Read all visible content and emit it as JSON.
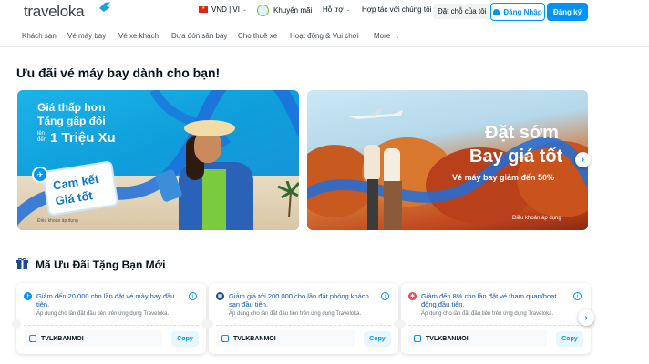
{
  "header": {
    "logo_text": "traveloka",
    "currency_label": "VND | VI",
    "promo_label": "Khuyến mãi",
    "support_label": "Hỗ trợ",
    "partner_label": "Hợp tác với chúng tôi",
    "my_booking_label": "Đặt chỗ của tôi",
    "login_label": "Đăng Nhập",
    "signup_label": "Đăng ký"
  },
  "subnav": {
    "items": [
      {
        "label": "Khách sạn"
      },
      {
        "label": "Vé máy bay"
      },
      {
        "label": "Vé xe khách"
      },
      {
        "label": "Đưa đón sân bay"
      },
      {
        "label": "Cho thuê xe"
      },
      {
        "label": "Hoạt động & Vui chơi"
      },
      {
        "label": "More"
      }
    ]
  },
  "flights_section": {
    "title": "Ưu đãi vé máy bay dành cho bạn!",
    "banners": [
      {
        "line1": "Giá thấp hơn",
        "line2": "Tặng gấp đôi",
        "upto": "lên đến",
        "line3": "1 Triệu Xu",
        "card_line1": "Cam kết",
        "card_line2": "Giá tốt",
        "tnc": "Điều khoản áp dụng"
      },
      {
        "title1": "Đặt sớm",
        "title2": "Bay giá tốt",
        "subtitle": "Vé máy bay giảm đến 50%",
        "tnc": "Điều khoản áp dụng"
      }
    ]
  },
  "coupons_section": {
    "title": "Mã Ưu Đãi Tặng Bạn Mới",
    "coupons": [
      {
        "title": "Giảm đến 20,000 cho lần đặt vé máy bay đầu tiên.",
        "desc": "Áp dụng cho lần đặt đầu tiên trên ứng dụng Traveloka.",
        "code": "TVLKBANMOI",
        "copy_label": "Copy",
        "icon_color": "#0194f3"
      },
      {
        "title": "Giảm giá tới 200.000 cho lần đặt phòng khách sạn đầu tiên.",
        "desc": "Áp dụng cho lần đặt đầu tiên trên ứng dụng Traveloka.",
        "code": "TVLKBANMOI",
        "copy_label": "Copy",
        "icon_color": "#1a4b8c"
      },
      {
        "title": "Giảm đến 8% cho lần đặt vé tham quan/hoạt động đầu tiên.",
        "desc": "Áp dụng cho lần đặt đầu tiên trên ứng dụng Traveloka.",
        "code": "TVLKBANMOI",
        "copy_label": "Copy",
        "icon_color": "#e8464e"
      }
    ]
  },
  "colors": {
    "brand_blue": "#0194f3",
    "text_dark": "#03121a"
  }
}
